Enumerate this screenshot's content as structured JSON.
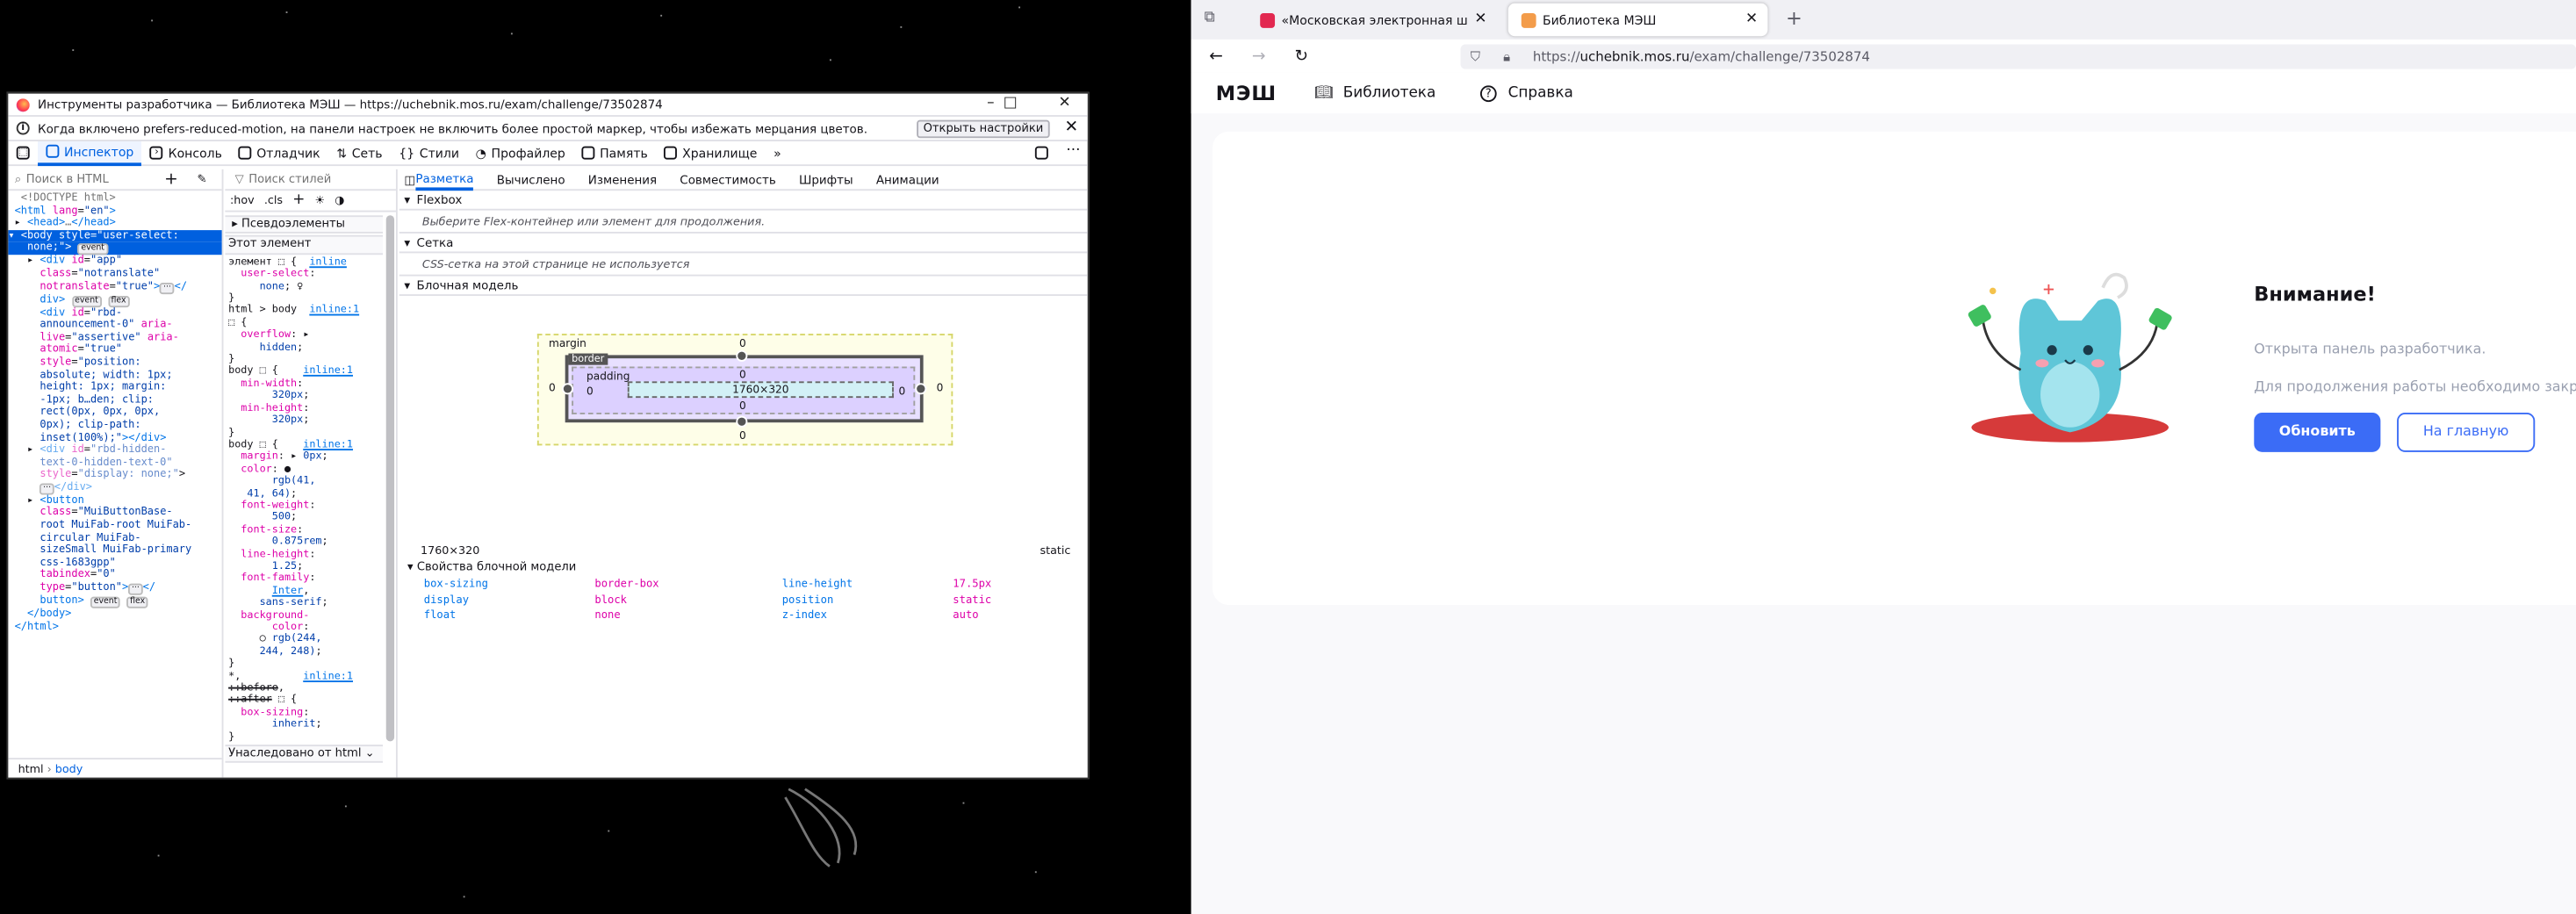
{
  "devtools": {
    "title": "Инструменты разработчика — Библиотека МЭШ — https://uchebnik.mos.ru/exam/challenge/73502874",
    "notice": "Когда включено prefers-reduced-motion, на панели настроек не включить более простой маркер, чтобы избежать мерцания цветов.",
    "notice_button": "Открыть настройки",
    "tabs": [
      "Инспектор",
      "Консоль",
      "Отладчик",
      "Сеть",
      "Стили",
      "Профайлер",
      "Память",
      "Хранилище"
    ],
    "html_search_placeholder": "Поиск в HTML",
    "breadcrumbs": [
      "html",
      "body"
    ],
    "rules_search_placeholder": "Поиск стилей",
    "rules_tools": [
      ":hov",
      ".cls"
    ],
    "pseudo_elements": "Псевдоэлементы",
    "this_element": "Этот элемент",
    "inherited_from": "Унаследовано от html",
    "layout_tabs": [
      "Разметка",
      "Вычислено",
      "Изменения",
      "Совместимость",
      "Шрифты",
      "Анимации"
    ],
    "flexbox_header": "Flexbox",
    "flexbox_note": "Выберите Flex-контейнер или элемент для продолжения.",
    "grid_header": "Сетка",
    "grid_note": "CSS-сетка на этой странице не используется",
    "boxmodel_header": "Блочная модель",
    "boxmodel": {
      "margin_label": "margin",
      "border_label": "border",
      "padding_label": "padding",
      "content_size": "1760×320",
      "zero": "0",
      "size_readout": "1760×320",
      "position_readout": "static"
    },
    "boxmodel_props_header": "Свойства блочной модели",
    "boxmodel_props": [
      [
        "box-sizing",
        "border-box",
        "line-height",
        "17.5px"
      ],
      [
        "display",
        "block",
        "position",
        "static"
      ],
      [
        "float",
        "none",
        "z-index",
        "auto"
      ]
    ]
  },
  "browser": {
    "tabs": [
      {
        "label": "«Московская электронная ш",
        "color": "#e22850"
      },
      {
        "label": "Библиотека МЭШ",
        "color": "#f39c4a"
      }
    ],
    "url_prefix": "https://",
    "url_domain": "uchebnik.mos.ru",
    "url_path": "/exam/challenge/73502874",
    "site": {
      "logo": "МЭШ",
      "nav": [
        "Библиотека",
        "Справка"
      ],
      "alert_title": "Внимание!",
      "alert_line1": "Открыта панель разработчика.",
      "alert_line2": "Для продолжения работы необходимо закрыть е",
      "refresh_button": "Обновить",
      "home_button": "На главную"
    }
  }
}
